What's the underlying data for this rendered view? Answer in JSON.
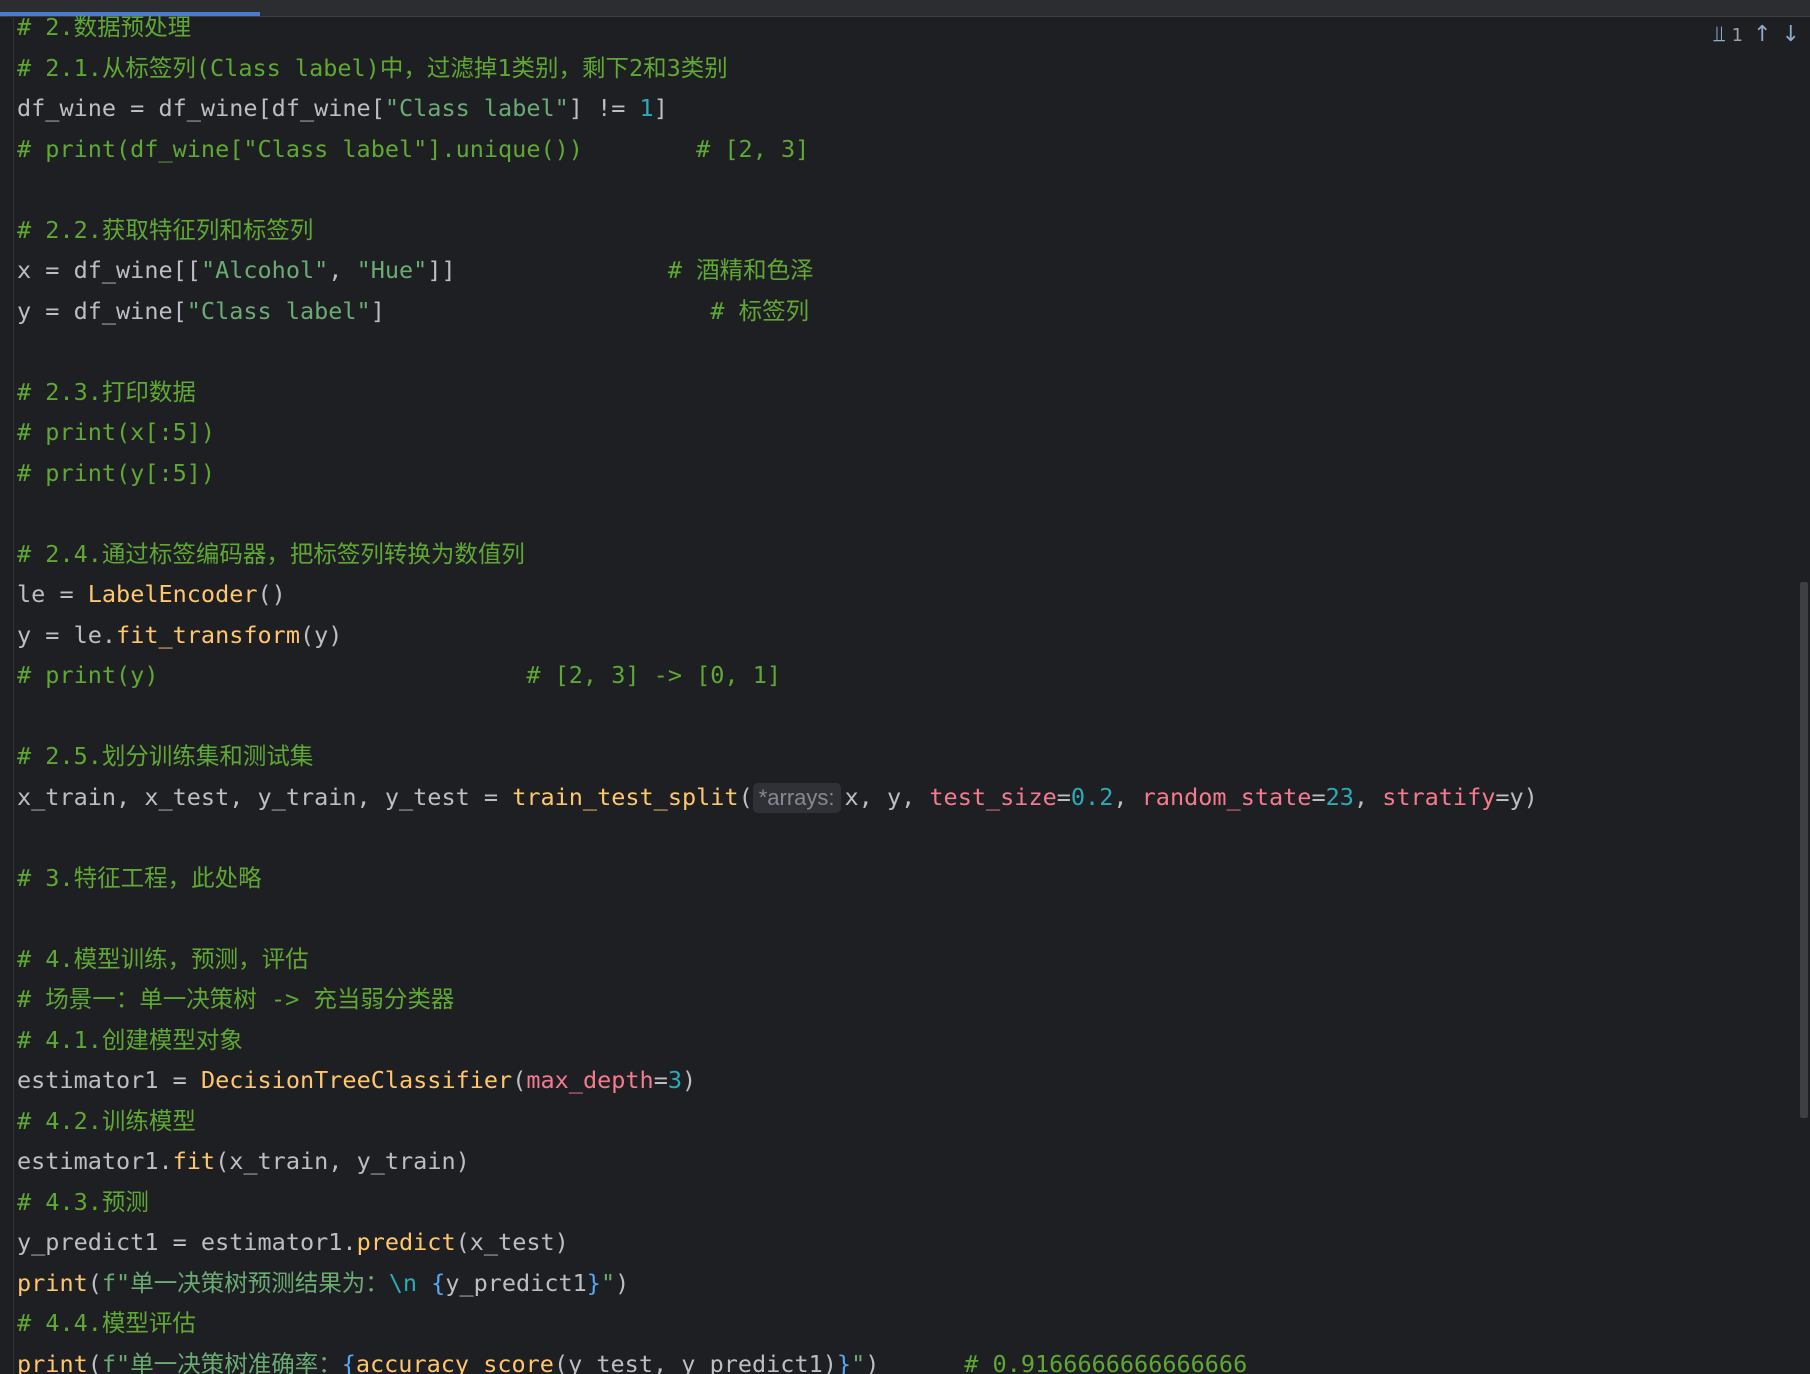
{
  "nav": {
    "match_count": "1",
    "replace_icon": "replace-icon",
    "prev_icon": "arrow-up-icon",
    "next_icon": "arrow-down-icon"
  },
  "param_hint": "*arrays:",
  "lines": [
    {
      "id": "l00",
      "segments": [
        {
          "t": "# 2.数据预处理",
          "c": "c-comment"
        }
      ]
    },
    {
      "id": "l01",
      "segments": [
        {
          "t": "# 2.1.从标签列(Class label)中，过滤掉1类别，剩下2和3类别",
          "c": "c-comment"
        }
      ]
    },
    {
      "id": "l02",
      "segments": [
        {
          "t": "df_wine = df_wine[df_wine[",
          "c": ""
        },
        {
          "t": "\"Class label\"",
          "c": "c-str"
        },
        {
          "t": "] != ",
          "c": ""
        },
        {
          "t": "1",
          "c": "c-num"
        },
        {
          "t": "]",
          "c": ""
        }
      ]
    },
    {
      "id": "l03",
      "segments": [
        {
          "t": "# print(df_wine[\"Class label\"].unique())        # [2, 3]",
          "c": "c-comment"
        }
      ]
    },
    {
      "id": "l04",
      "segments": []
    },
    {
      "id": "l05",
      "segments": [
        {
          "t": "# 2.2.获取特征列和标签列",
          "c": "c-comment"
        }
      ]
    },
    {
      "id": "l06",
      "segments": [
        {
          "t": "x = df_wine[[",
          "c": ""
        },
        {
          "t": "\"Alcohol\"",
          "c": "c-str"
        },
        {
          "t": ", ",
          "c": ""
        },
        {
          "t": "\"Hue\"",
          "c": "c-str"
        },
        {
          "t": "]]               ",
          "c": ""
        },
        {
          "t": "# 酒精和色泽",
          "c": "c-comment"
        }
      ]
    },
    {
      "id": "l07",
      "segments": [
        {
          "t": "y = df_wine[",
          "c": ""
        },
        {
          "t": "\"Class label\"",
          "c": "c-str"
        },
        {
          "t": "]                       ",
          "c": ""
        },
        {
          "t": "# 标签列",
          "c": "c-comment"
        }
      ]
    },
    {
      "id": "l08",
      "segments": []
    },
    {
      "id": "l09",
      "segments": [
        {
          "t": "# 2.3.打印数据",
          "c": "c-comment"
        }
      ]
    },
    {
      "id": "l10",
      "segments": [
        {
          "t": "# print(x[:5])",
          "c": "c-comment"
        }
      ]
    },
    {
      "id": "l11",
      "segments": [
        {
          "t": "# print(y[:5])",
          "c": "c-comment"
        }
      ]
    },
    {
      "id": "l12",
      "segments": []
    },
    {
      "id": "l13",
      "segments": [
        {
          "t": "# 2.4.通过标签编码器，把标签列转换为数值列",
          "c": "c-comment"
        }
      ]
    },
    {
      "id": "l14",
      "segments": [
        {
          "t": "le = ",
          "c": ""
        },
        {
          "t": "LabelEncoder",
          "c": "c-call"
        },
        {
          "t": "()",
          "c": ""
        }
      ]
    },
    {
      "id": "l15",
      "segments": [
        {
          "t": "y = le.",
          "c": ""
        },
        {
          "t": "fit_transform",
          "c": "c-call"
        },
        {
          "t": "(y)",
          "c": ""
        }
      ]
    },
    {
      "id": "l16",
      "segments": [
        {
          "t": "# print(y)                          # [2, 3] -> [0, 1]",
          "c": "c-comment"
        }
      ]
    },
    {
      "id": "l17",
      "segments": []
    },
    {
      "id": "l18",
      "segments": [
        {
          "t": "# 2.5.划分训练集和测试集",
          "c": "c-comment"
        }
      ]
    },
    {
      "id": "l19",
      "hint_after": 2,
      "segments": [
        {
          "t": "x_train, x_test, y_train, y_test = ",
          "c": ""
        },
        {
          "t": "train_test_split",
          "c": "c-call"
        },
        {
          "t": "(",
          "c": ""
        },
        {
          "t": "x, y, ",
          "c": ""
        },
        {
          "t": "test_size",
          "c": "c-param"
        },
        {
          "t": "=",
          "c": ""
        },
        {
          "t": "0.2",
          "c": "c-num"
        },
        {
          "t": ", ",
          "c": ""
        },
        {
          "t": "random_state",
          "c": "c-param"
        },
        {
          "t": "=",
          "c": ""
        },
        {
          "t": "23",
          "c": "c-num"
        },
        {
          "t": ", ",
          "c": ""
        },
        {
          "t": "stratify",
          "c": "c-param"
        },
        {
          "t": "=y)",
          "c": ""
        }
      ]
    },
    {
      "id": "l20",
      "segments": []
    },
    {
      "id": "l21",
      "segments": [
        {
          "t": "# 3.特征工程，此处略",
          "c": "c-comment"
        }
      ]
    },
    {
      "id": "l22",
      "segments": []
    },
    {
      "id": "l23",
      "segments": [
        {
          "t": "# 4.模型训练，预测，评估",
          "c": "c-comment"
        }
      ]
    },
    {
      "id": "l24",
      "segments": [
        {
          "t": "# 场景一：单一决策树 -> 充当弱分类器",
          "c": "c-comment"
        }
      ]
    },
    {
      "id": "l25",
      "segments": [
        {
          "t": "# 4.1.创建模型对象",
          "c": "c-comment"
        }
      ]
    },
    {
      "id": "l26",
      "segments": [
        {
          "t": "estimator1 = ",
          "c": ""
        },
        {
          "t": "DecisionTreeClassifier",
          "c": "c-call"
        },
        {
          "t": "(",
          "c": ""
        },
        {
          "t": "max_depth",
          "c": "c-param"
        },
        {
          "t": "=",
          "c": ""
        },
        {
          "t": "3",
          "c": "c-num"
        },
        {
          "t": ")",
          "c": ""
        }
      ]
    },
    {
      "id": "l27",
      "segments": [
        {
          "t": "# 4.2.训练模型",
          "c": "c-comment"
        }
      ]
    },
    {
      "id": "l28",
      "segments": [
        {
          "t": "estimator1.",
          "c": ""
        },
        {
          "t": "fit",
          "c": "c-call"
        },
        {
          "t": "(x_train, y_train)",
          "c": ""
        }
      ]
    },
    {
      "id": "l29",
      "segments": [
        {
          "t": "# 4.3.预测",
          "c": "c-comment"
        }
      ]
    },
    {
      "id": "l30",
      "segments": [
        {
          "t": "y_predict1 = estimator1.",
          "c": ""
        },
        {
          "t": "predict",
          "c": "c-call"
        },
        {
          "t": "(x_test)",
          "c": ""
        }
      ]
    },
    {
      "id": "l31",
      "segments": [
        {
          "t": "print",
          "c": "c-call"
        },
        {
          "t": "(",
          "c": ""
        },
        {
          "t": "f\"单一决策树预测结果为：",
          "c": "c-fstr"
        },
        {
          "t": "\\n",
          "c": "c-esc"
        },
        {
          "t": " ",
          "c": "c-fstr"
        },
        {
          "t": "{",
          "c": "c-builtin"
        },
        {
          "t": "y_predict1",
          "c": ""
        },
        {
          "t": "}",
          "c": "c-builtin"
        },
        {
          "t": "\"",
          "c": "c-fstr"
        },
        {
          "t": ")",
          "c": ""
        }
      ]
    },
    {
      "id": "l32",
      "segments": [
        {
          "t": "# 4.4.模型评估",
          "c": "c-comment"
        }
      ]
    },
    {
      "id": "l33",
      "segments": [
        {
          "t": "print",
          "c": "c-call"
        },
        {
          "t": "(",
          "c": ""
        },
        {
          "t": "f\"单一决策树准确率：",
          "c": "c-fstr"
        },
        {
          "t": "{",
          "c": "c-builtin"
        },
        {
          "t": "accuracy_score",
          "c": "c-call"
        },
        {
          "t": "(y_test, y_predict1)",
          "c": ""
        },
        {
          "t": "}",
          "c": "c-builtin"
        },
        {
          "t": "\"",
          "c": "c-fstr"
        },
        {
          "t": ")      ",
          "c": ""
        },
        {
          "t": "# 0.9166666666666666",
          "c": "c-comment"
        }
      ]
    }
  ]
}
